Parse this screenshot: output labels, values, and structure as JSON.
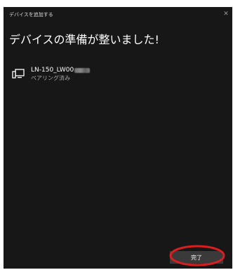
{
  "window": {
    "title": "デバイスを追加する",
    "close_glyph": "✕"
  },
  "heading": "デバイスの準備が整いました!",
  "device": {
    "icon": "display-device-icon",
    "name": "LN-150_LW00",
    "status": "ペアリング済み"
  },
  "footer": {
    "done_label": "完了"
  },
  "colors": {
    "background": "#171717",
    "text": "#ffffff",
    "secondary_text": "#a6a6a6",
    "button": "#3a3a3a",
    "highlight": "#d81e1e"
  }
}
